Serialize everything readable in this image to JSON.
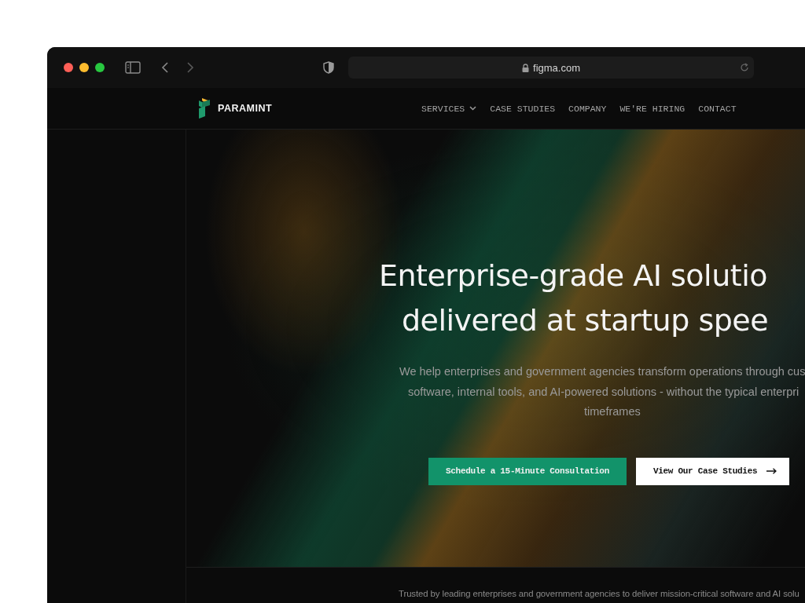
{
  "browser": {
    "url": "figma.com"
  },
  "nav": {
    "brand": "PARAMINT",
    "links": [
      {
        "label": "SERVICES",
        "has_menu": true
      },
      {
        "label": "CASE STUDIES",
        "has_menu": false
      },
      {
        "label": "COMPANY",
        "has_menu": false
      },
      {
        "label": "WE'RE HIRING",
        "has_menu": false
      },
      {
        "label": "CONTACT",
        "has_menu": false
      }
    ]
  },
  "hero": {
    "heading_lines": [
      "Enterprise-grade AI solutio",
      "delivered at startup spee"
    ],
    "subtitle_lines": [
      "We help enterprises and government agencies transform operations through cus",
      "software, internal tools, and AI-powered solutions - without the typical enterpri",
      "timeframes"
    ],
    "buttons": [
      {
        "label": "Schedule a 15-Minute Consultation",
        "kind": "primary"
      },
      {
        "label": "View Our Case Studies",
        "kind": "secondary"
      }
    ]
  },
  "trusted": "Trusted by leading enterprises and government agencies to deliver mission-critical software and AI solu"
}
